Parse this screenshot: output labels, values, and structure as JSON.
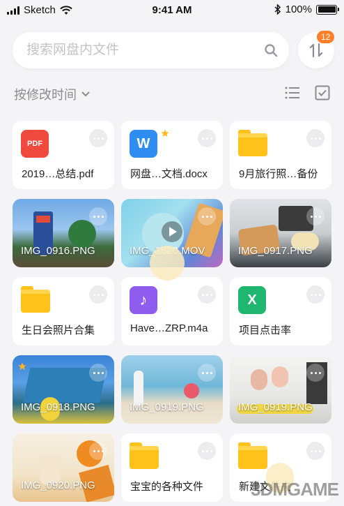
{
  "status": {
    "carrier": "Sketch",
    "time": "9:41 AM",
    "battery": "100%",
    "battery_level": 1.0
  },
  "search": {
    "placeholder": "搜索网盘内文件",
    "icon": "search-icon"
  },
  "toolbar": {
    "sort_icon": "sort-arrows-icon",
    "badge_count": "12",
    "filter_label": "按修改时间",
    "list_view_icon": "list-icon",
    "select_icon": "checkbox-icon"
  },
  "colors": {
    "accent": "#ff7f2a",
    "folder": "#ffc21a",
    "pdf": "#f0493e",
    "word": "#2f8cf1",
    "music": "#8f5cf0",
    "excel": "#1fb670"
  },
  "files": [
    {
      "name": "2019…总结.pdf",
      "type": "pdf",
      "icon_text": "PDF"
    },
    {
      "name": "网盘…文档.docx",
      "type": "word",
      "icon_text": "W",
      "starred": true
    },
    {
      "name": "9月旅行照…备份",
      "type": "folder"
    },
    {
      "name": "IMG_0916.PNG",
      "type": "image"
    },
    {
      "name": "IMG_1820.MOV",
      "type": "video"
    },
    {
      "name": "IMG_0917.PNG",
      "type": "image"
    },
    {
      "name": "生日会照片合集",
      "type": "folder"
    },
    {
      "name": "Have…ZRP.m4a",
      "type": "music",
      "icon_text": "♪"
    },
    {
      "name": "项目点击率",
      "type": "excel",
      "icon_text": "X"
    },
    {
      "name": "IMG_0918.PNG",
      "type": "image",
      "starred": true
    },
    {
      "name": "IMG_0919.PNG",
      "type": "image"
    },
    {
      "name": "IMG_0919.PNG",
      "type": "image"
    },
    {
      "name": "IMG_0920.PNG",
      "type": "image"
    },
    {
      "name": "宝宝的各种文件",
      "type": "folder"
    },
    {
      "name": "新建文件夹",
      "type": "folder"
    }
  ],
  "watermark": "3DMGAME"
}
